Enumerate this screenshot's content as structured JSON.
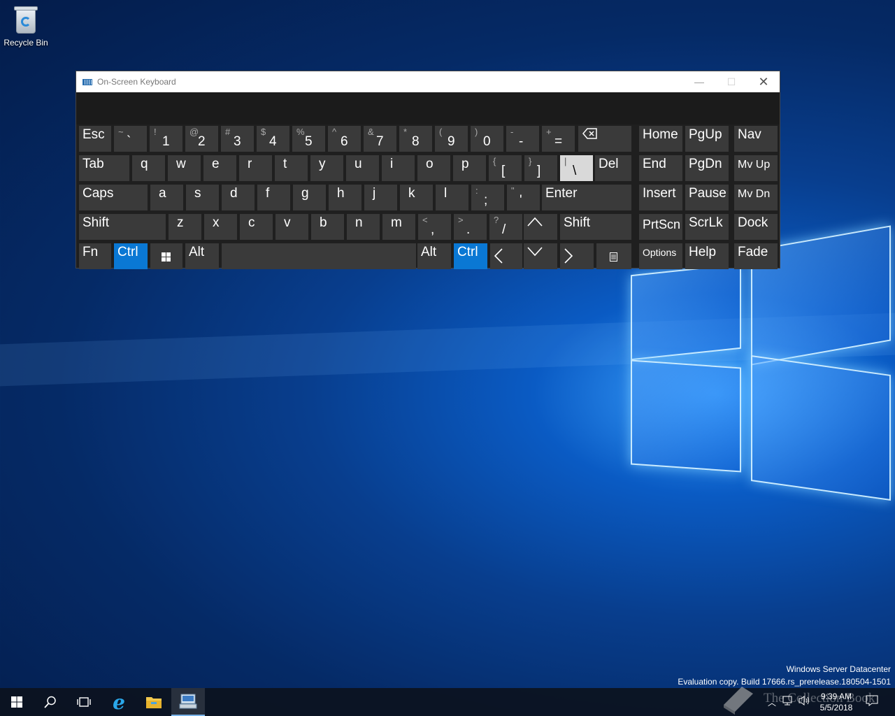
{
  "desktop": {
    "recycle_bin_label": "Recycle Bin",
    "watermark_line1": "Windows Server Datacenter",
    "watermark_line2": "Evaluation copy. Build 17666.rs_prerelease.180504-1501",
    "brand_text": "The Collection Book"
  },
  "window": {
    "title": "On-Screen Keyboard",
    "minimize_glyph": "—",
    "maximize_glyph": "☐",
    "close_glyph": "✕"
  },
  "keys": {
    "esc": "Esc",
    "tab": "Tab",
    "caps": "Caps",
    "shift_left": "Shift",
    "fn": "Fn",
    "ctrl_left": "Ctrl",
    "alt_left": "Alt",
    "alt_right": "Alt",
    "ctrl_right": "Ctrl",
    "shift_right": "Shift",
    "enter": "Enter",
    "del": "Del",
    "home": "Home",
    "pgup": "PgUp",
    "nav": "Nav",
    "end": "End",
    "pgdn": "PgDn",
    "mvup": "Mv Up",
    "insert": "Insert",
    "pause": "Pause",
    "mvdn": "Mv Dn",
    "prtscn": "PrtScn",
    "scrlk": "ScrLk",
    "dock": "Dock",
    "options": "Options",
    "help": "Help",
    "fade": "Fade",
    "row1": [
      {
        "s": "~",
        "m": "`"
      },
      {
        "s": "!",
        "m": "1"
      },
      {
        "s": "@",
        "m": "2"
      },
      {
        "s": "#",
        "m": "3"
      },
      {
        "s": "$",
        "m": "4"
      },
      {
        "s": "%",
        "m": "5"
      },
      {
        "s": "^",
        "m": "6"
      },
      {
        "s": "&",
        "m": "7"
      },
      {
        "s": "*",
        "m": "8"
      },
      {
        "s": "(",
        "m": "9"
      },
      {
        "s": ")",
        "m": "0"
      },
      {
        "s": "-",
        "m": "-"
      },
      {
        "s": "+",
        "m": "="
      }
    ],
    "row2": [
      "q",
      "w",
      "e",
      "r",
      "t",
      "y",
      "u",
      "i",
      "o",
      "p"
    ],
    "row2_sym": [
      {
        "s": "{",
        "m": "["
      },
      {
        "s": "}",
        "m": "]"
      },
      {
        "s": "|",
        "m": "\\"
      }
    ],
    "row3": [
      "a",
      "s",
      "d",
      "f",
      "g",
      "h",
      "j",
      "k",
      "l"
    ],
    "row3_sym": [
      {
        "s": ":",
        "m": ";"
      },
      {
        "s": "\"",
        "m": "'"
      }
    ],
    "row4": [
      "z",
      "x",
      "c",
      "v",
      "b",
      "n",
      "m"
    ],
    "row4_sym": [
      {
        "s": "<",
        "m": ","
      },
      {
        "s": ">",
        "m": "."
      },
      {
        "s": "?",
        "m": "/"
      }
    ]
  },
  "taskbar": {
    "time": "9:39 AM",
    "date": "5/5/2018"
  }
}
